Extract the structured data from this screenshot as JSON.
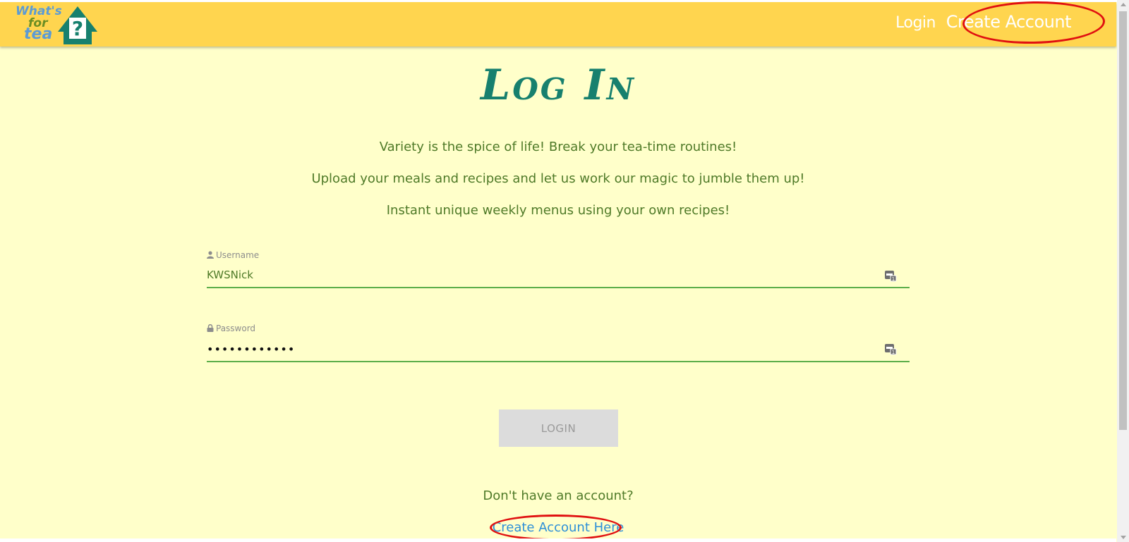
{
  "logo": {
    "line1": "What's",
    "line2": "for",
    "line3": "tea",
    "mark": "?"
  },
  "nav": {
    "login": "Login",
    "create_account": "Create Account"
  },
  "title": "Log In",
  "taglines": [
    "Variety is the spice of life! Break your tea-time routines!",
    "Upload your meals and recipes and let us work our magic to jumble them up!",
    "Instant unique weekly menus using your own recipes!"
  ],
  "form": {
    "username_label": "Username",
    "username_value": "KWSNick",
    "password_label": "Password",
    "password_value": "••••••••••••",
    "login_button": "LOGIN"
  },
  "footer": {
    "no_account": "Don't have an account?",
    "create_link": "Create Account Here"
  },
  "colors": {
    "navbar": "#ffd54f",
    "background": "#ffffca",
    "title": "#17806e",
    "text": "#4f7a28",
    "link": "#2d8fd8",
    "annotation": "#e01010"
  }
}
